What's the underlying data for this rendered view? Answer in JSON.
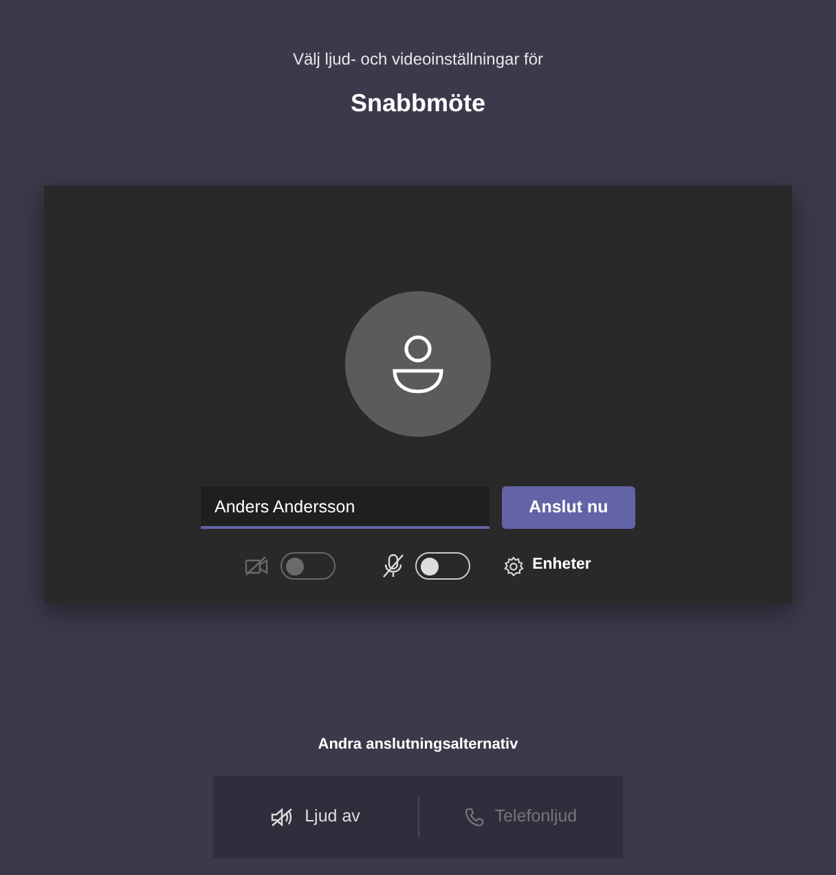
{
  "header": {
    "subtitle": "Välj ljud- och videoinställningar för",
    "title": "Snabbmöte"
  },
  "name_field": {
    "value": "Anders Andersson"
  },
  "join_button": "Anslut nu",
  "toggles": [
    {
      "kind": "camera",
      "on": false,
      "disabled": true
    },
    {
      "kind": "microphone",
      "on": false,
      "disabled": false
    }
  ],
  "devices_button": "Enheter",
  "other_options": {
    "title": "Andra anslutningsalternativ",
    "items": [
      {
        "kind": "audio-off",
        "label": "Ljud av",
        "disabled": false
      },
      {
        "kind": "phone",
        "label": "Telefonljud",
        "disabled": true
      }
    ]
  }
}
